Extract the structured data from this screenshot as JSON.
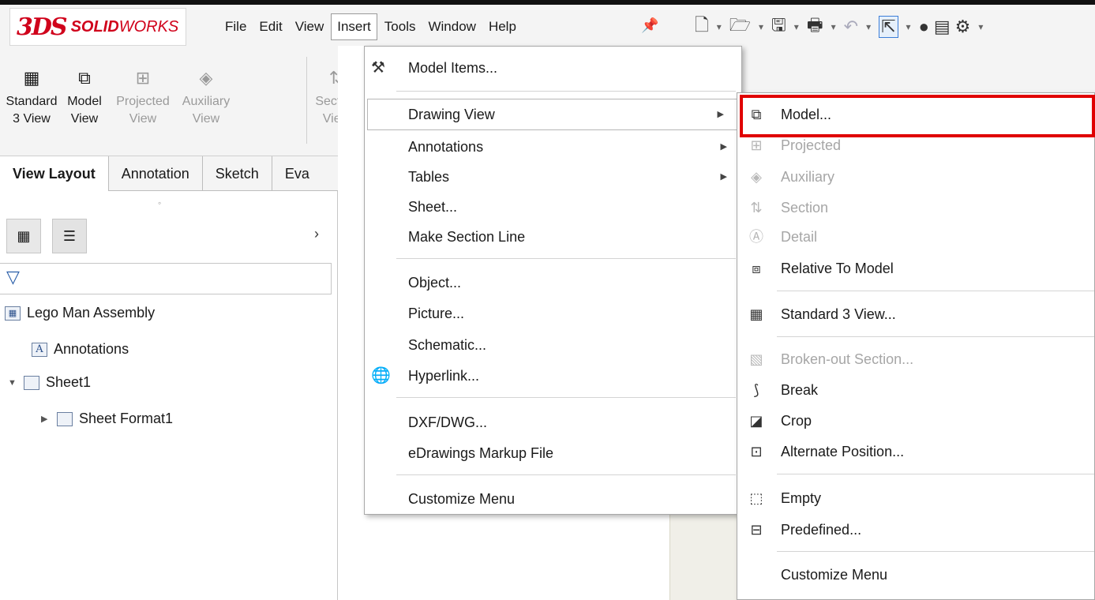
{
  "app": {
    "logo_mark": "3DS",
    "logo_brand_bold": "SOLID",
    "logo_brand_light": "WORKS"
  },
  "menubar": {
    "items": [
      "File",
      "Edit",
      "View",
      "Insert",
      "Tools",
      "Window",
      "Help"
    ],
    "active": "Insert"
  },
  "ribbon": {
    "buttons": [
      {
        "line1": "Standard",
        "line2": "3 View",
        "enabled": true
      },
      {
        "line1": "Model",
        "line2": "View",
        "enabled": true
      },
      {
        "line1": "Projected",
        "line2": "View",
        "enabled": false
      },
      {
        "line1": "Auxiliary",
        "line2": "View",
        "enabled": false
      },
      {
        "line1": "Section",
        "line2": "View",
        "enabled": false
      }
    ]
  },
  "tabs": [
    "View Layout",
    "Annotation",
    "Sketch",
    "Eva"
  ],
  "tree": {
    "root": "Lego Man Assembly",
    "annotations": "Annotations",
    "sheet": "Sheet1",
    "sheet_format": "Sheet Format1"
  },
  "insert_menu": [
    {
      "label": "Model Items...",
      "icon": "model-items-icon",
      "submenu": false
    },
    {
      "label": "Drawing View",
      "submenu": true
    },
    {
      "label": "Annotations",
      "submenu": true
    },
    {
      "label": "Tables",
      "submenu": true
    },
    {
      "label": "Sheet...",
      "submenu": false
    },
    {
      "label": "Make Section Line",
      "submenu": false
    },
    {
      "label": "Object...",
      "submenu": false
    },
    {
      "label": "Picture...",
      "submenu": false
    },
    {
      "label": "Schematic...",
      "submenu": false
    },
    {
      "label": "Hyperlink...",
      "icon": "hyperlink-icon",
      "submenu": false
    },
    {
      "label": "DXF/DWG...",
      "submenu": false
    },
    {
      "label": "eDrawings Markup File",
      "submenu": false
    },
    {
      "label": "Customize Menu",
      "submenu": false
    }
  ],
  "drawing_view_submenu": [
    {
      "label": "Model...",
      "enabled": true,
      "icon": "model-view-icon"
    },
    {
      "label": "Projected",
      "enabled": false,
      "icon": "projected-view-icon"
    },
    {
      "label": "Auxiliary",
      "enabled": false,
      "icon": "auxiliary-view-icon"
    },
    {
      "label": "Section",
      "enabled": false,
      "icon": "section-view-icon"
    },
    {
      "label": "Detail",
      "enabled": false,
      "icon": "detail-view-icon"
    },
    {
      "label": "Relative To Model",
      "enabled": true,
      "icon": "relative-view-icon"
    },
    {
      "label": "Standard 3 View...",
      "enabled": true,
      "icon": "standard-3-view-icon"
    },
    {
      "label": "Broken-out Section...",
      "enabled": false,
      "icon": "broken-out-section-icon"
    },
    {
      "label": "Break",
      "enabled": true,
      "icon": "break-icon"
    },
    {
      "label": "Crop",
      "enabled": true,
      "icon": "crop-icon"
    },
    {
      "label": "Alternate Position...",
      "enabled": true,
      "icon": "alternate-position-icon"
    },
    {
      "label": "Empty",
      "enabled": true,
      "icon": "empty-view-icon"
    },
    {
      "label": "Predefined...",
      "enabled": true,
      "icon": "predefined-view-icon"
    },
    {
      "label": "Customize Menu",
      "enabled": true
    }
  ],
  "colors": {
    "highlight_box": "#e00000",
    "brand": "#d0021b",
    "pin": "#2a66b7"
  }
}
